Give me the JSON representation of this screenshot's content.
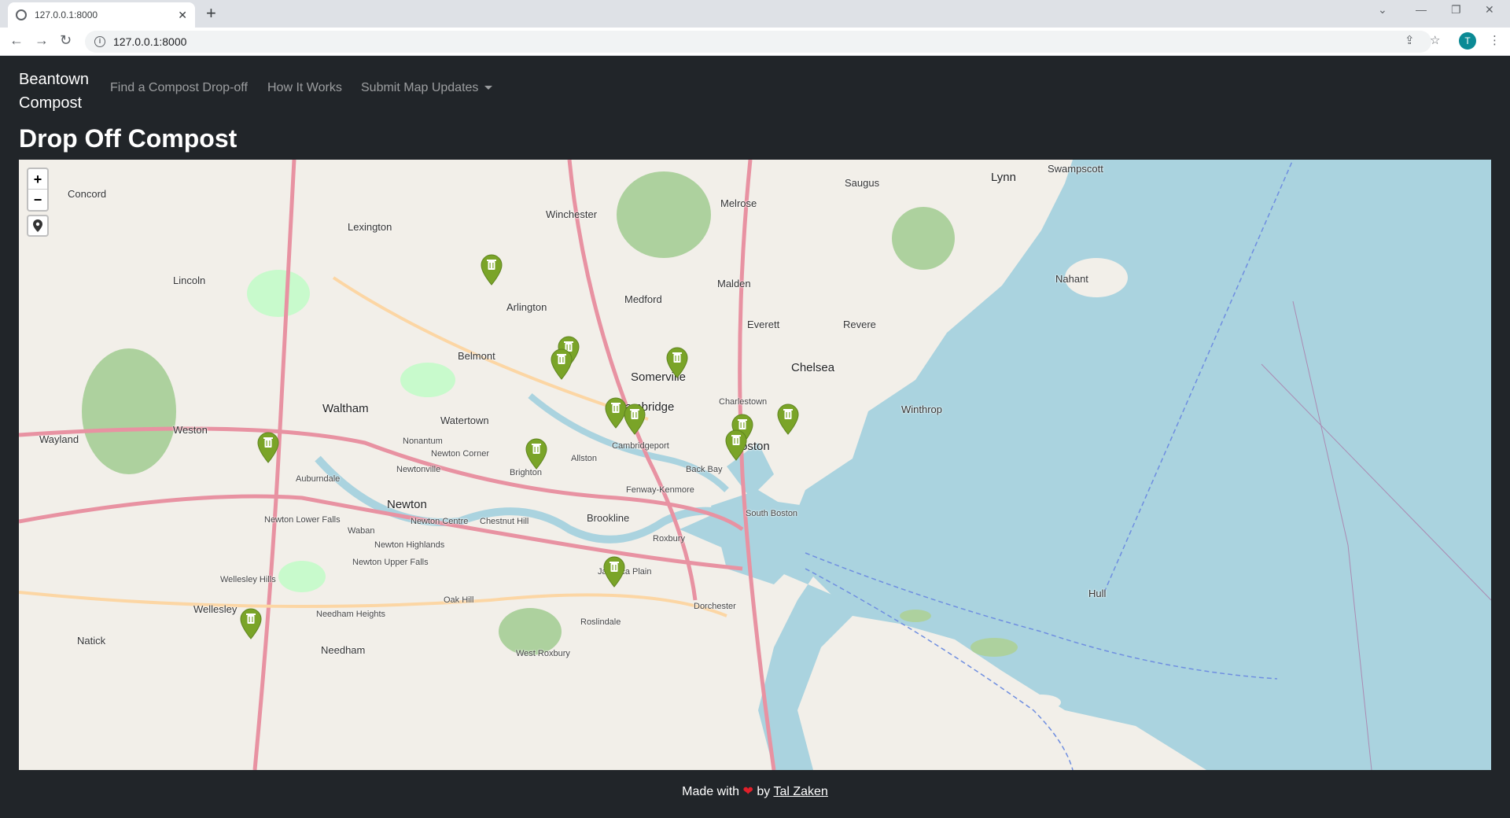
{
  "browser": {
    "tab_title": "127.0.0.1:8000",
    "url": "127.0.0.1:8000",
    "profile_initial": "T"
  },
  "nav": {
    "brand_line1": "Beantown",
    "brand_line2": "Compost",
    "links": [
      "Find a Compost Drop-off",
      "How It Works",
      "Submit Map Updates"
    ]
  },
  "page": {
    "title": "Drop Off Compost"
  },
  "map": {
    "zoom_in": "+",
    "zoom_out": "−",
    "marker_color": "#7aa428",
    "water_color": "#aad3df",
    "labels": {
      "concord": "Concord",
      "lexington": "Lexington",
      "winchester": "Winchester",
      "melrose": "Melrose",
      "saugus": "Saugus",
      "lynn": "Lynn",
      "swampscott": "Swampscott",
      "lincoln": "Lincoln",
      "arlington": "Arlington",
      "medford": "Medford",
      "malden": "Malden",
      "nahant": "Nahant",
      "everett": "Everett",
      "revere": "Revere",
      "belmont": "Belmont",
      "somerville": "Somerville",
      "chelsea": "Chelsea",
      "waltham": "Waltham",
      "watertown": "Watertown",
      "charlestown": "Charlestown",
      "cambridge": "Cambridge",
      "winthrop": "Winthrop",
      "wayland": "Wayland",
      "weston": "Weston",
      "nonantum": "Nonantum",
      "boston": "Boston",
      "newton_corner": "Newton Corner",
      "allston": "Allston",
      "cambridgeport": "Cambridgeport",
      "brighton": "Brighton",
      "newtonville": "Newtonville",
      "auburndale": "Auburndale",
      "back_bay": "Back Bay",
      "fenway": "Fenway-Kenmore",
      "newton": "Newton",
      "brookline": "Brookline",
      "south_boston": "South Boston",
      "newton_lower_falls": "Newton Lower Falls",
      "waban": "Waban",
      "newton_centre": "Newton Centre",
      "chestnut_hill": "Chestnut Hill",
      "roxbury": "Roxbury",
      "newton_highlands": "Newton Highlands",
      "newton_upper_falls": "Newton Upper Falls",
      "jamaica_plain": "Jamaica Plain",
      "wellesley_hills": "Wellesley Hills",
      "hull": "Hull",
      "oak_hill": "Oak Hill",
      "dorchester": "Dorchester",
      "wellesley": "Wellesley",
      "needham_heights": "Needham Heights",
      "roslindale": "Roslindale",
      "natick": "Natick",
      "needham": "Needham",
      "west_roxbury": "West Roxbury"
    }
  },
  "footer": {
    "made_with": "Made with",
    "by": "by",
    "author": "Tal Zaken"
  }
}
